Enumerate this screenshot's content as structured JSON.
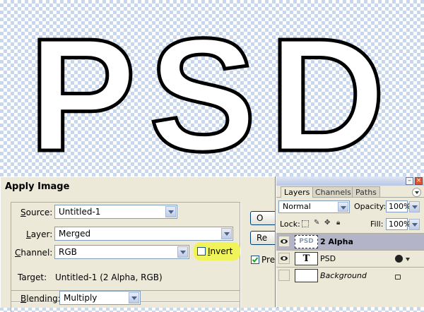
{
  "canvas": {
    "text": "PSD"
  },
  "apply_image": {
    "title": "Apply Image",
    "source": {
      "label": "Source:",
      "value": "Untitled-1"
    },
    "layer": {
      "label": "Layer:",
      "value": "Merged"
    },
    "channel": {
      "label": "Channel:",
      "value": "RGB"
    },
    "invert": {
      "label": "Invert",
      "checked": false
    },
    "target": {
      "label": "Target:",
      "value": "Untitled-1 (2 Alpha, RGB)"
    },
    "blending": {
      "label": "Blending:",
      "value": "Multiply"
    },
    "buttons": {
      "ok_partial": "O",
      "reset_partial": "Re"
    },
    "preview": {
      "label_partial": "Pre",
      "checked": true
    }
  },
  "layers_panel": {
    "tabs": [
      "Layers",
      "Channels",
      "Paths"
    ],
    "active_tab": "Layers",
    "blend_mode": "Normal",
    "opacity_label": "Opacity:",
    "opacity": "100%",
    "lock_label": "Lock:",
    "fill_label": "Fill:",
    "fill": "100%",
    "layers": [
      {
        "name": "2 Alpha",
        "thumb": "PSD",
        "visible": true,
        "selected": true
      },
      {
        "name": "PSD",
        "thumb": "T",
        "visible": true,
        "selected": false,
        "type": "text"
      },
      {
        "name": "Background",
        "thumb": "",
        "visible": false,
        "selected": false,
        "locked": true
      }
    ]
  },
  "colors": {
    "highlight": "#f0f45a",
    "checker": "#c6d7ee",
    "selected_row": "#b4b4c8"
  }
}
